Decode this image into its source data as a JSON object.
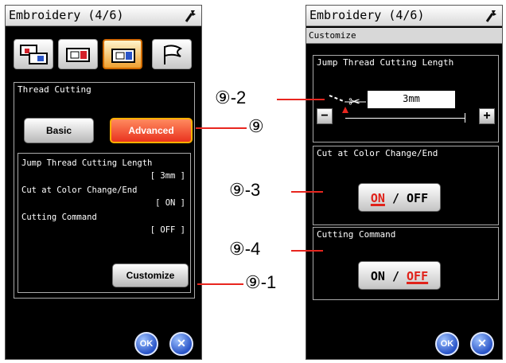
{
  "left_screen": {
    "title": "Embroidery (4/6)",
    "tabs": [
      "tab-1",
      "tab-2",
      "tab-3",
      "tab-4"
    ],
    "thread_cutting": {
      "title": "Thread Cutting",
      "basic_label": "Basic",
      "advanced_label": "Advanced",
      "info": [
        "Jump Thread Cutting Length",
        "[ 3mm ]",
        "Cut at Color Change/End",
        "[ ON ]",
        "Cutting Command",
        "[ OFF ]"
      ],
      "customize_label": "Customize"
    },
    "ok_label": "OK",
    "cancel_label": "✕"
  },
  "right_screen": {
    "title": "Embroidery (4/6)",
    "subtitle": "Customize",
    "jump": {
      "title": "Jump Thread Cutting Length",
      "value": "3mm",
      "minus": "−",
      "plus": "+"
    },
    "cut_color": {
      "title": "Cut at Color Change/End",
      "on": "ON",
      "sep": " / ",
      "off": "OFF",
      "selected": "on"
    },
    "cutting_command": {
      "title": "Cutting Command",
      "on": "ON",
      "sep": " / ",
      "off": "OFF",
      "selected": "off"
    },
    "ok_label": "OK",
    "cancel_label": "✕"
  },
  "callouts": {
    "c9": "⑨",
    "c9_1": "⑨-1",
    "c9_2": "⑨-2",
    "c9_3": "⑨-3",
    "c9_4": "⑨-4"
  },
  "colors": {
    "accent_red": "#e8261f",
    "advanced_orange": "#e9331f",
    "ok_blue": "#2a55c8"
  }
}
